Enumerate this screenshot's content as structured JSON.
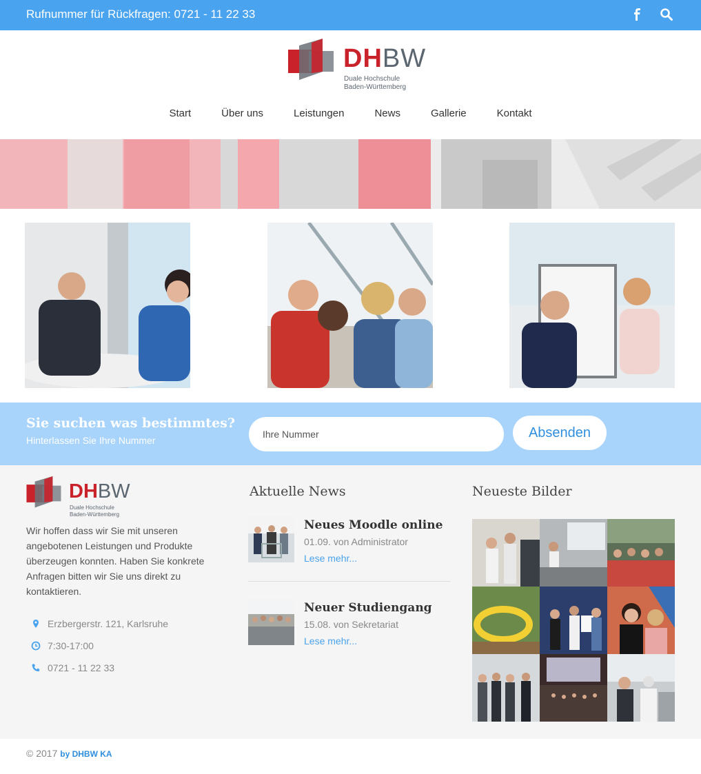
{
  "topbar": {
    "phone": "Rufnummer für Rückfragen: 0721 - 11 22 33",
    "icons": [
      "facebook-icon",
      "search-icon"
    ]
  },
  "logo": {
    "dh": "DH",
    "bw": "BW",
    "line1": "Duale Hochschule",
    "line2": "Baden-Württemberg"
  },
  "nav": {
    "items": [
      "Start",
      "Über uns",
      "Leistungen",
      "News",
      "Gallerie",
      "Kontakt"
    ]
  },
  "cta": {
    "title": "Sie suchen was bestimmtes?",
    "subtitle": "Hinterlassen Sie Ihre Nummer",
    "input_placeholder": "Ihre Nummer",
    "button": "Absenden"
  },
  "footer": {
    "about": "Wir hoffen dass wir Sie mit unseren angebotenen Leistungen und Produkte überzeugen konnten. Haben Sie konkrete Anfragen bitten wir Sie uns direkt zu kontaktieren.",
    "address": "Erzbergerstr. 121, Karlsruhe",
    "hours": "7:30-17:00",
    "phone": "0721 - 11 22 33",
    "news_title": "Aktuelle News",
    "news": [
      {
        "title": "Neues Moodle online",
        "meta": "01.09. von Administrator",
        "link": "Lese mehr..."
      },
      {
        "title": "Neuer Studiengang",
        "meta": "15.08. von Sekretariat",
        "link": "Lese mehr..."
      }
    ],
    "gallery_title": "Neueste Bilder"
  },
  "copyright": {
    "text": "© 2017",
    "by": "by DHBW KA"
  },
  "colors": {
    "primary": "#4aa3ee",
    "cta": "#a8d4fb",
    "brand_red": "#c9222b",
    "brand_gray": "#5c6670"
  }
}
